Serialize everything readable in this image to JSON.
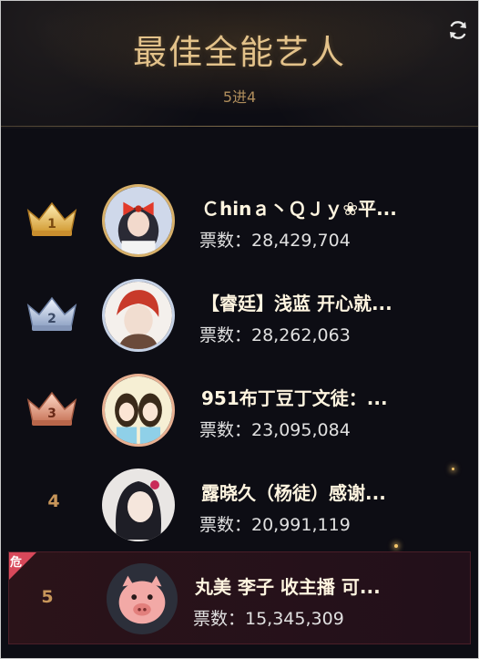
{
  "header": {
    "title": "最佳全能艺人",
    "subtitle": "5进4"
  },
  "colors": {
    "accent": "#e3c28a",
    "danger": "#d8485a",
    "background": "#0d0d14"
  },
  "ranking": [
    {
      "rank": "1",
      "crown": "gold",
      "name": "Ｃhinａ丶ＱＪｙ❀平...",
      "votes": "票数：28,429,704"
    },
    {
      "rank": "2",
      "crown": "silver",
      "name": "【睿廷】浅蓝 开心就...",
      "votes": "票数：28,262,063"
    },
    {
      "rank": "3",
      "crown": "bronze",
      "name": "951布丁豆丁文徒：...",
      "votes": "票数：23,095,084"
    },
    {
      "rank": "4",
      "name": "露晓久（杨徒）感谢...",
      "votes": "票数：20,991,119"
    },
    {
      "rank": "5",
      "name": "丸美 李子 收主播 可...",
      "votes": "票数：15,345,309",
      "badge": "危"
    }
  ],
  "icons": {
    "refresh": "refresh-icon"
  }
}
